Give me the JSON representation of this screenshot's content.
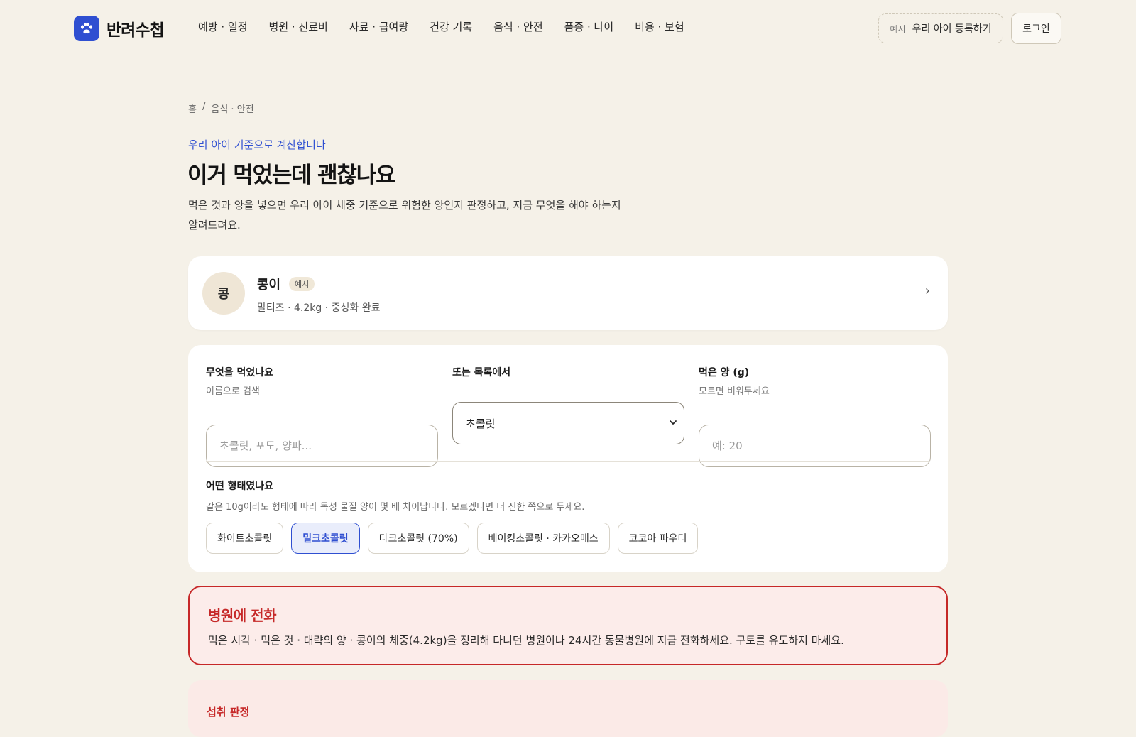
{
  "header": {
    "brand": "반려수첩",
    "nav": [
      "예방 · 일정",
      "병원 · 진료비",
      "사료 · 급여량",
      "건강 기록",
      "음식 · 안전",
      "품종 · 나이",
      "비용 · 보험"
    ],
    "register_tag": "예시",
    "register_label": "우리 아이 등록하기",
    "login_label": "로그인"
  },
  "breadcrumb": {
    "home": "홈",
    "separator": "/",
    "current": "음식 · 안전"
  },
  "intro": {
    "kicker": "우리 아이 기준으로 계산합니다",
    "title": "이거 먹었는데 괜찮나요",
    "description": "먹은 것과 양을 넣으면 우리 아이 체중 기준으로 위험한 양인지 판정하고, 지금 무엇을 해야 하는지 알려드려요."
  },
  "pet": {
    "avatar_initial": "콩",
    "name": "콩이",
    "badge": "예시",
    "meta": "말티즈 · 4.2kg · 중성화 완료",
    "chevron": "›"
  },
  "form": {
    "search": {
      "label": "무엇을 먹었나요",
      "hint": "이름으로 검색",
      "placeholder": "초콜릿, 포도, 양파...",
      "value": ""
    },
    "list": {
      "label": "또는 목록에서",
      "selected": "초콜릿"
    },
    "amount": {
      "label": "먹은 양 (g)",
      "hint": "모르면 비워두세요",
      "placeholder": "예: 20",
      "value": ""
    },
    "form_type": {
      "label": "어떤 형태였나요",
      "hint": "같은 10g이라도 형태에 따라 독성 물질 양이 몇 배 차이납니다. 모르겠다면 더 진한 쪽으로 두세요.",
      "options": [
        "화이트초콜릿",
        "밀크초콜릿",
        "다크초콜릿 (70%)",
        "베이킹초콜릿 · 카카오매스",
        "코코아 파우더"
      ],
      "selected_index": 1
    }
  },
  "alert": {
    "title": "병원에 전화",
    "body": "먹은 시각 · 먹은 것 · 대략의 양 · 콩이의 체중(4.2kg)을 정리해 다니던 병원이나 24시간 동물병원에 지금 전화하세요. 구토를 유도하지 마세요."
  },
  "verdict": {
    "title": "섭취 판정"
  },
  "colors": {
    "accent": "#2f4fd1",
    "danger": "#c62828",
    "background": "#f5f1e8"
  },
  "icons": {
    "logo": "paw-icon",
    "select": "chevron-down-icon",
    "pet_link": "chevron-right-icon"
  }
}
